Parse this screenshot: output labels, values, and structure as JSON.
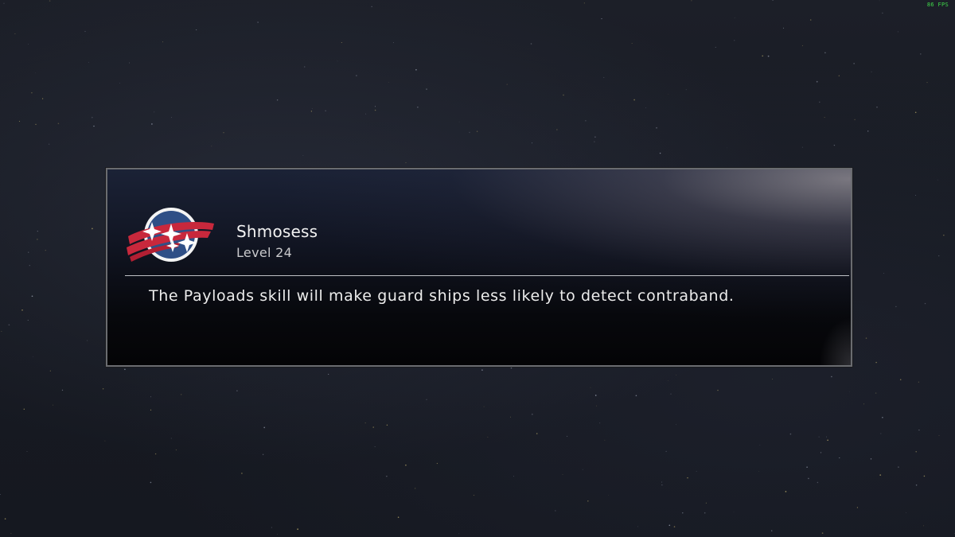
{
  "hud": {
    "fps": "86 FPS"
  },
  "dialog": {
    "character_name": "Shmosess",
    "character_level": "Level 24",
    "message": "The Payloads skill will make guard ships less likely to detect contraband.",
    "emblem_icon": "constellation-emblem-icon"
  },
  "colors": {
    "emblem_blue": "#2f4f86",
    "emblem_red": "#c8283c",
    "fps_green": "#3fd84a"
  }
}
